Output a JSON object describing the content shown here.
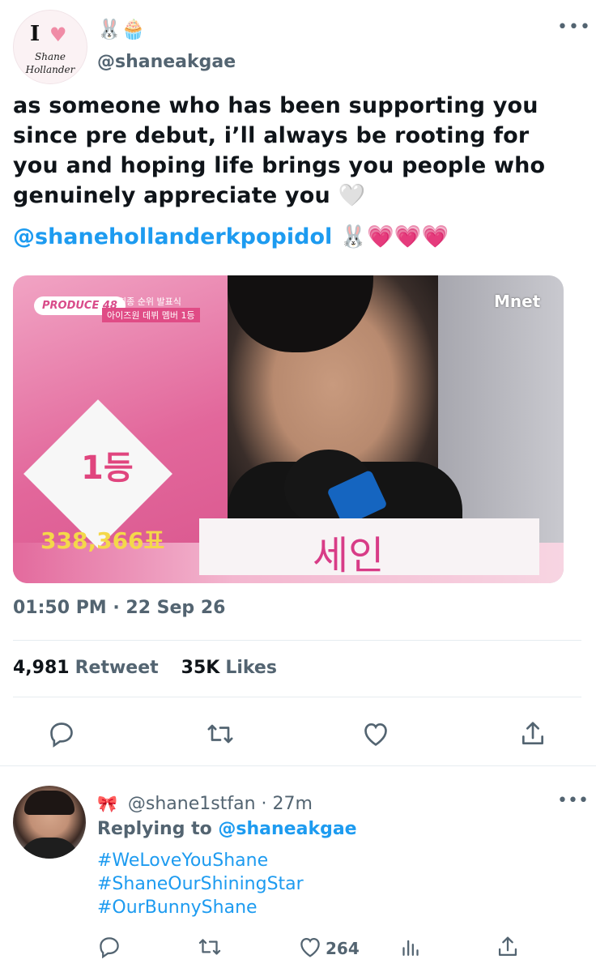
{
  "tweet": {
    "display_name": "🐰🧁",
    "handle": "@shaneakgae",
    "avatar": {
      "line1": "I",
      "heart": "♥",
      "line2": "Shane",
      "line3": "Hollander"
    },
    "more": "•••",
    "text": "as someone who has been supporting you since pre debut, i’ll always be rooting for you and hoping life brings you people who genuinely appreciate you 🤍",
    "mention": "@shanehollanderkpopidol",
    "mention_emojis": "🐰💗💗💗",
    "media": {
      "logo_badge": "PRODUCE 48",
      "caption_top": "최종 순위 발표식",
      "caption_sub": "아이즈원 데뷔 멤버 1등",
      "rank": "1등",
      "votes": "338,366표",
      "name": "세인",
      "channel": "Mnet"
    },
    "timestamp": "01:50 PM · 22 Sep 26",
    "stats": {
      "retweets": "4,981",
      "retweets_label": "Retweet",
      "likes": "35K",
      "likes_label": "Likes"
    },
    "icons": [
      "reply-icon",
      "retweet-icon",
      "like-icon",
      "share-icon"
    ]
  },
  "reply": {
    "bow": "🎀",
    "handle": "@shane1stfan",
    "separator": "·",
    "time": "27m",
    "more": "•••",
    "replying_label": "Replying to",
    "replying_to": "@shaneakgae",
    "hashtags": [
      "#WeLoveYouShane",
      "#ShaneOurShiningStar",
      "#OurBunnyShane"
    ],
    "like_count": "264",
    "icons": [
      "reply-icon",
      "retweet-icon",
      "like-icon",
      "analytics-icon",
      "share-icon"
    ]
  },
  "colors": {
    "accent": "#1d9bf0",
    "muted": "#536471",
    "text": "#0f1419",
    "pink": "#e2679b"
  }
}
